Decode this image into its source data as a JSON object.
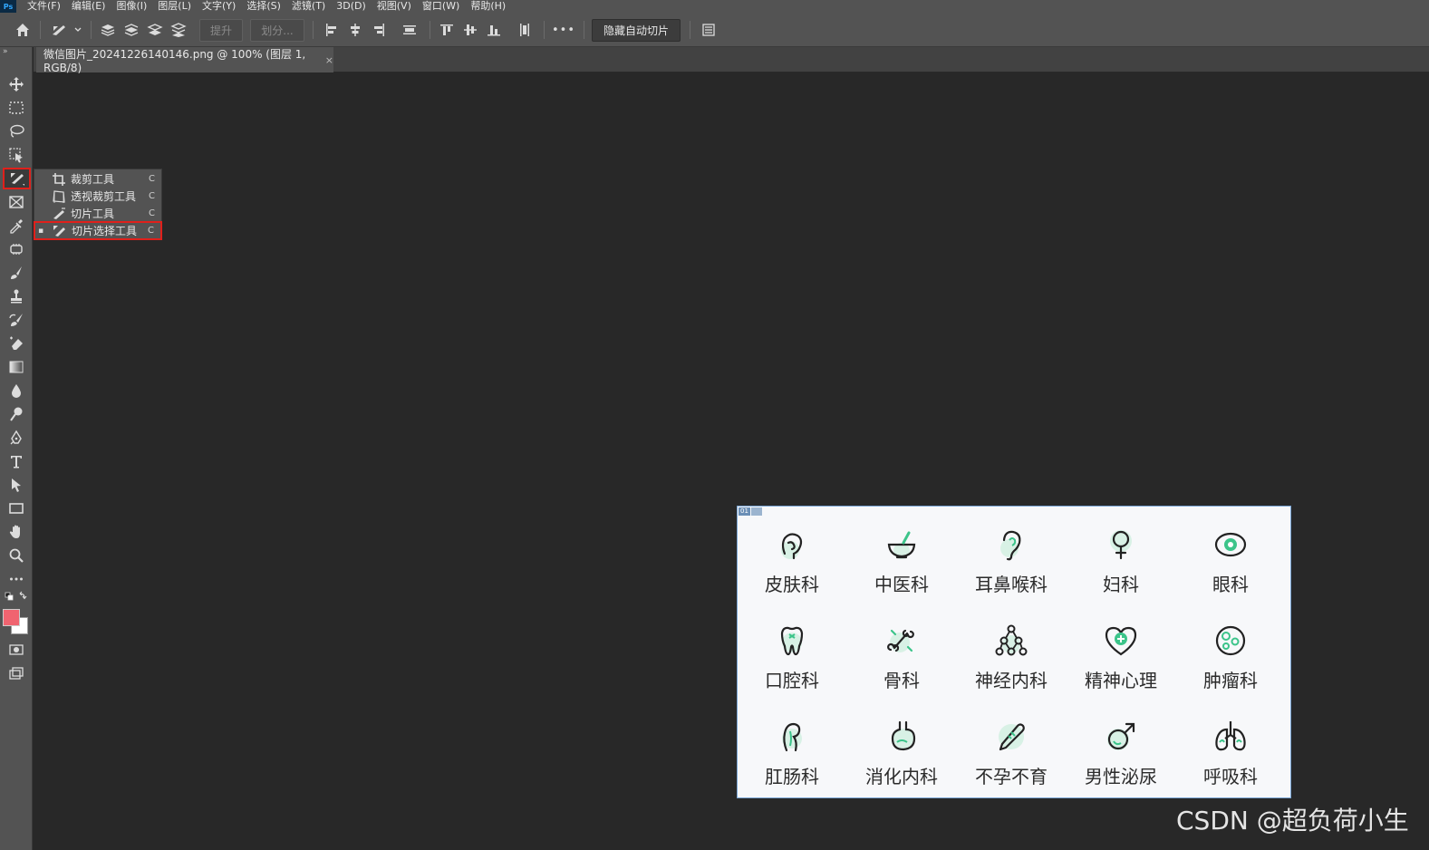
{
  "app": {
    "logo": "Ps",
    "menu": [
      "文件(F)",
      "编辑(E)",
      "图像(I)",
      "图层(L)",
      "文字(Y)",
      "选择(S)",
      "滤镜(T)",
      "3D(D)",
      "视图(V)",
      "窗口(W)",
      "帮助(H)"
    ]
  },
  "options_bar": {
    "promote_label": "提升",
    "divide_label": "划分...",
    "more_label": "•••",
    "hide_auto_slices_label": "隐藏自动切片"
  },
  "panel": {
    "collapse_glyph": "»"
  },
  "document_tab": {
    "title": "微信图片_20241226140146.png @ 100% (图层 1, RGB/8)",
    "close_glyph": "×"
  },
  "tool_flyout": {
    "items": [
      {
        "label": "裁剪工具",
        "key": "C",
        "icon": "crop-icon"
      },
      {
        "label": "透视裁剪工具",
        "key": "C",
        "icon": "perspective-crop-icon"
      },
      {
        "label": "切片工具",
        "key": "C",
        "icon": "slice-icon"
      },
      {
        "label": "切片选择工具",
        "key": "C",
        "icon": "slice-select-icon",
        "selected": true
      }
    ]
  },
  "canvas": {
    "slice_number": "01",
    "departments": [
      {
        "name": "皮肤科",
        "icon": "skin-icon"
      },
      {
        "name": "中医科",
        "icon": "tcm-icon"
      },
      {
        "name": "耳鼻喉科",
        "icon": "ear-icon"
      },
      {
        "name": "妇科",
        "icon": "female-icon"
      },
      {
        "name": "眼科",
        "icon": "eye-icon"
      },
      {
        "name": "口腔科",
        "icon": "tooth-icon"
      },
      {
        "name": "骨科",
        "icon": "bone-icon"
      },
      {
        "name": "神经内科",
        "icon": "neuron-icon"
      },
      {
        "name": "精神心理",
        "icon": "heart-icon"
      },
      {
        "name": "肿瘤科",
        "icon": "tumor-icon"
      },
      {
        "name": "肛肠科",
        "icon": "intestine-icon"
      },
      {
        "name": "消化内科",
        "icon": "stomach-icon"
      },
      {
        "name": "不孕不育",
        "icon": "thermometer-icon"
      },
      {
        "name": "男性泌尿",
        "icon": "male-icon"
      },
      {
        "name": "呼吸科",
        "icon": "lungs-icon"
      }
    ],
    "accent_color": "#3cc48a"
  },
  "watermark": "CSDN @超负荷小生",
  "colors": {
    "foreground": "#f06470",
    "background": "#ffffff"
  }
}
